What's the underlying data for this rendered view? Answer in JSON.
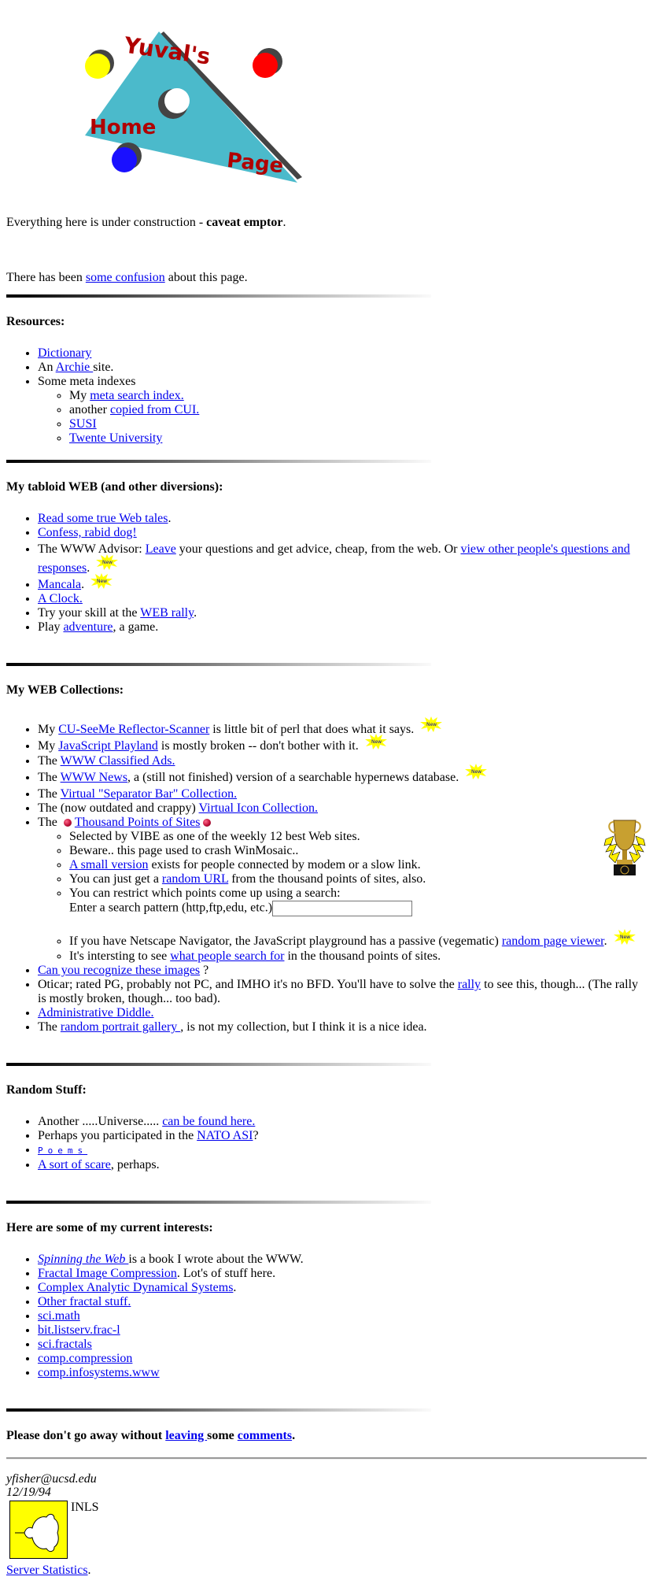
{
  "header": {
    "logo_alt": "Yuval's Home Page",
    "logo_words": [
      "Yuval's",
      "Home",
      "Page"
    ]
  },
  "intro": {
    "text_before": "Everything here is under construction - ",
    "bold": "caveat emptor",
    "text_after": "."
  },
  "confusion": {
    "before": "There has been ",
    "link": "some confusion",
    "after": " about this page."
  },
  "new_badge_label": "New",
  "resources": {
    "heading": "Resources:",
    "items": [
      {
        "link": "Dictionary"
      },
      {
        "before": "An ",
        "link": "Archie ",
        "after": "site."
      },
      {
        "text": "Some meta indexes"
      }
    ],
    "subitems": [
      {
        "before": "My ",
        "link": "meta search index."
      },
      {
        "before": "another ",
        "link": "copied from CUI."
      },
      {
        "link": "SUSI"
      },
      {
        "link": "Twente University"
      }
    ]
  },
  "tabloid": {
    "heading": "My tabloid WEB (and other diversions):",
    "items": [
      {
        "link": "Read some true Web tales",
        "after": "."
      },
      {
        "link": "Confess, rabid dog!"
      },
      {
        "before": "The WWW Advisor: ",
        "link": "Leave",
        "middle": " your questions and get advice, cheap, from the web. Or ",
        "link2": "view other people's questions and responses",
        "after": "."
      },
      {
        "link": "Mancala",
        "after": "."
      },
      {
        "link": "A Clock."
      },
      {
        "before": "Try your skill at the ",
        "link": "WEB rally",
        "after": "."
      },
      {
        "before": "Play ",
        "link": "adventure",
        "after": ", a game."
      }
    ]
  },
  "collections": {
    "heading": "My WEB Collections:",
    "items": [
      {
        "before": "My ",
        "link": "CU-SeeMe Reflector-Scanner",
        "after": " is little bit of perl that does what it says."
      },
      {
        "before": "My ",
        "link": "JavaScript Playland",
        "after": " is mostly broken -- don't bother with it."
      },
      {
        "before": "The ",
        "link": "WWW Classified Ads."
      },
      {
        "before": "The ",
        "link": "WWW News",
        "after": ", a (still not finished) version of a searchable hypernews database."
      },
      {
        "before": "The ",
        "link": "Virtual \"Separator Bar\" Collection."
      },
      {
        "before": "The (now outdated and crappy) ",
        "link": "Virtual Icon Collection."
      },
      {
        "before": "The ",
        "link": "Thousand Points of Sites"
      }
    ],
    "tpos_sub": [
      {
        "text": "Selected by VIBE as one of the weekly 12 best Web sites."
      },
      {
        "text": "Beware.. this page used to crash WinMosaic.."
      },
      {
        "link": "A small version",
        "after": " exists for people connected by modem or a slow link."
      },
      {
        "before": "You can just get a ",
        "link": "random URL",
        "after": " from the thousand points of sites, also."
      },
      {
        "text": "You can restrict which points come up using a search:"
      },
      {
        "before": "If you have Netscape Navigator, the JavaScript playground has a passive (vegematic) ",
        "link": "random page viewer",
        "after": "."
      },
      {
        "before": "It's intersting to see ",
        "link": "what people search for",
        "after": " in the thousand points of sites."
      }
    ],
    "search_label": "Enter a search pattern (http,ftp,edu, etc.)",
    "search_value": "",
    "after_items": [
      {
        "link": "Can you recognize these images",
        "after": " ?"
      },
      {
        "before": "Oticar; rated PG, probably not PC, and IMHO it's no BFD. You'll have to solve the ",
        "link": "rally",
        "after": " to see this, though... (The rally is mostly broken, though... too bad)."
      },
      {
        "link": "Administrative Diddle."
      },
      {
        "before": "The ",
        "link": "random portrait gallery ",
        "after": ", is not my collection, but I think it is a nice idea."
      }
    ]
  },
  "random": {
    "heading": "Random Stuff:",
    "items": [
      {
        "before": "Another .....Universe..... ",
        "link": "can be found here."
      },
      {
        "before": "Perhaps you participated in the ",
        "link": "NATO ASI",
        "after": "?"
      },
      {
        "link": "Poems"
      },
      {
        "link": "A sort of scare",
        "after": ", perhaps."
      }
    ]
  },
  "interests": {
    "heading": "Here are some of my current interests:",
    "items": [
      {
        "link": "Spinning the Web ",
        "after": "is a book I wrote about the WWW."
      },
      {
        "link": "Fractal Image Compression",
        "after": ". Lot's of stuff here."
      },
      {
        "link": "Complex Analytic Dynamical Systems",
        "after": "."
      },
      {
        "link": "Other fractal stuff."
      },
      {
        "link": "sci.math"
      },
      {
        "link": "bit.listserv.frac-l"
      },
      {
        "link": "sci.fractals"
      },
      {
        "link": "comp.compression"
      },
      {
        "link": "comp.infosystems.www"
      }
    ]
  },
  "closing": {
    "before": "Please don't go away without ",
    "link1": "leaving ",
    "middle": "some ",
    "link2": "comments",
    "after": "."
  },
  "footer": {
    "email": "yfisher@ucsd.edu",
    "date": "12/19/94",
    "inls_label": "INLS",
    "server_stats_link": "Server Statistics",
    "server_stats_after": "."
  },
  "colors": {
    "link": "#0000ee",
    "visited": "#551a8b",
    "triangle": "#4bbacb",
    "logo_text": "#b00000",
    "new_badge": "#ffff00"
  }
}
